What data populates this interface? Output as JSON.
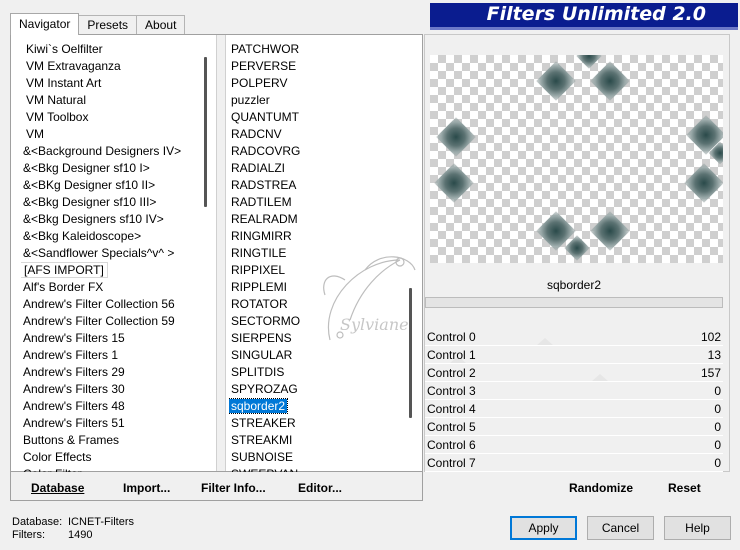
{
  "tabs": [
    {
      "label": "Navigator",
      "active": true
    },
    {
      "label": "Presets",
      "active": false
    },
    {
      "label": "About",
      "active": false
    }
  ],
  "title": "Filters Unlimited 2.0",
  "categories": [
    {
      "label": "Kiwi`s Oelfilter",
      "indent": true
    },
    {
      "label": "VM Extravaganza",
      "indent": true
    },
    {
      "label": "VM Instant Art",
      "indent": true
    },
    {
      "label": "VM Natural",
      "indent": true
    },
    {
      "label": "VM Toolbox",
      "indent": true
    },
    {
      "label": "VM",
      "indent": true
    },
    {
      "label": "&<Background Designers IV>"
    },
    {
      "label": "&<Bkg Designer sf10 I>"
    },
    {
      "label": "&<BKg Designer sf10 II>"
    },
    {
      "label": "&<Bkg Designer sf10 III>"
    },
    {
      "label": "&<Bkg Designers sf10 IV>"
    },
    {
      "label": "&<Bkg Kaleidoscope>"
    },
    {
      "label": "&<Sandflower Specials^v^ >"
    },
    {
      "label": "[AFS IMPORT]",
      "boxed": true
    },
    {
      "label": "Alf's Border FX"
    },
    {
      "label": "Andrew's Filter Collection 56"
    },
    {
      "label": "Andrew's Filter Collection 59"
    },
    {
      "label": "Andrew's Filters 15"
    },
    {
      "label": "Andrew's Filters 1"
    },
    {
      "label": "Andrew's Filters 29"
    },
    {
      "label": "Andrew's Filters 30"
    },
    {
      "label": "Andrew's Filters 48"
    },
    {
      "label": "Andrew's Filters 51"
    },
    {
      "label": "Buttons & Frames"
    },
    {
      "label": "Color Effects"
    },
    {
      "label": "Color Filter"
    }
  ],
  "filters": [
    {
      "label": "PATCHWOR"
    },
    {
      "label": "PERVERSE"
    },
    {
      "label": "POLPERV"
    },
    {
      "label": "puzzler"
    },
    {
      "label": "QUANTUMT"
    },
    {
      "label": "RADCNV"
    },
    {
      "label": "RADCOVRG"
    },
    {
      "label": "RADIALZI"
    },
    {
      "label": "RADSTREA"
    },
    {
      "label": "RADTILEM"
    },
    {
      "label": "REALRADM"
    },
    {
      "label": "RINGMIRR"
    },
    {
      "label": "RINGTILE"
    },
    {
      "label": "RIPPIXEL"
    },
    {
      "label": "RIPPLEMI"
    },
    {
      "label": "ROTATOR"
    },
    {
      "label": "SECTORMO"
    },
    {
      "label": "SIERPENS"
    },
    {
      "label": "SINGULAR"
    },
    {
      "label": "SPLITDIS"
    },
    {
      "label": "SPYROZAG"
    },
    {
      "label": "sqborder2",
      "selected": true
    },
    {
      "label": "STREAKER"
    },
    {
      "label": "STREAKMI"
    },
    {
      "label": "SUBNOISE"
    },
    {
      "label": "SWEEPVAN"
    }
  ],
  "panel_buttons": {
    "database": "Database",
    "import": "Import...",
    "filter_info": "Filter Info...",
    "editor": "Editor..."
  },
  "selected_filter_name": "sqborder2",
  "watermark": "Sylviane",
  "controls": [
    {
      "name": "Control 0",
      "value": "102",
      "level": 0.4
    },
    {
      "name": "Control 1",
      "value": "13",
      "level": 0.05
    },
    {
      "name": "Control 2",
      "value": "157",
      "level": 0.62
    },
    {
      "name": "Control 3",
      "value": "0",
      "level": 0
    },
    {
      "name": "Control 4",
      "value": "0",
      "level": 0
    },
    {
      "name": "Control 5",
      "value": "0",
      "level": 0
    },
    {
      "name": "Control 6",
      "value": "0",
      "level": 0
    },
    {
      "name": "Control 7",
      "value": "0",
      "level": 0
    }
  ],
  "right_buttons": {
    "randomize": "Randomize",
    "reset": "Reset"
  },
  "footer": {
    "database_label": "Database:",
    "database_value": "ICNET-Filters",
    "filters_label": "Filters:",
    "filters_value": "1490"
  },
  "dialog_buttons": {
    "apply": "Apply",
    "cancel": "Cancel",
    "help": "Help"
  },
  "colors": {
    "banner": "#0a1c8f",
    "selection": "#0078d7"
  }
}
